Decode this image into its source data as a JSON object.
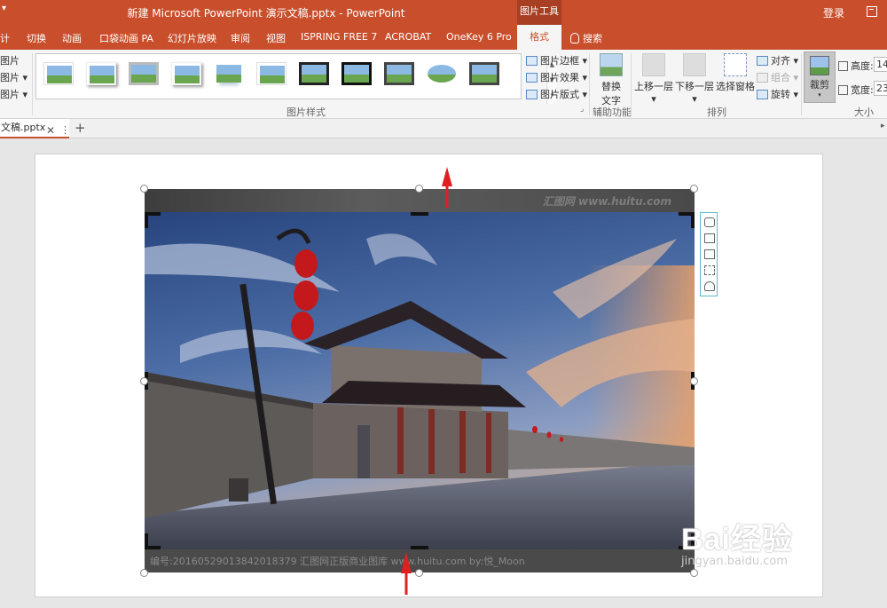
{
  "window": {
    "title": "新建 Microsoft PowerPoint 演示文稿.pptx - PowerPoint",
    "context_group": "图片工具",
    "login": "登录"
  },
  "tabs": [
    "计",
    "切换",
    "动画",
    "口袋动画 PA",
    "幻灯片放映",
    "审阅",
    "视图",
    "ISPRING FREE 7",
    "ACROBAT",
    "OneKey 6 Pro"
  ],
  "active_tab": "格式",
  "tell_me": "搜索",
  "ribbon": {
    "left_items": [
      "图片",
      "图片",
      "图片"
    ],
    "picture_styles": {
      "label": "图片样式",
      "border": "图片边框",
      "effects": "图片效果",
      "layout": "图片版式"
    },
    "accessibility": {
      "label": "辅助功能",
      "alt_text_line1": "替换",
      "alt_text_line2": "文字"
    },
    "arrange": {
      "label": "排列",
      "bring_forward": "上移一层",
      "send_backward": "下移一层",
      "selection_pane": "选择窗格",
      "align": "对齐",
      "group": "组合",
      "rotate": "旋转"
    },
    "size": {
      "label": "大小",
      "crop": "裁剪",
      "height_label": "高度:",
      "height_value": "14",
      "width_label": "宽度:",
      "width_value": "23"
    }
  },
  "document_tab": {
    "name": "文稿.pptx"
  },
  "picture": {
    "watermark_top": "汇图网 www.huitu.com",
    "watermark_bottom": "编号:20160529013842018379  汇图网正版商业图库 www.huitu.com  by:悦_Moon"
  },
  "overlay": {
    "brand": "Bai经验",
    "url": "jingyan.baidu.com"
  },
  "colors": {
    "accent": "#c94f2c",
    "context_tab": "#a83f22",
    "arrow": "#e02020"
  }
}
